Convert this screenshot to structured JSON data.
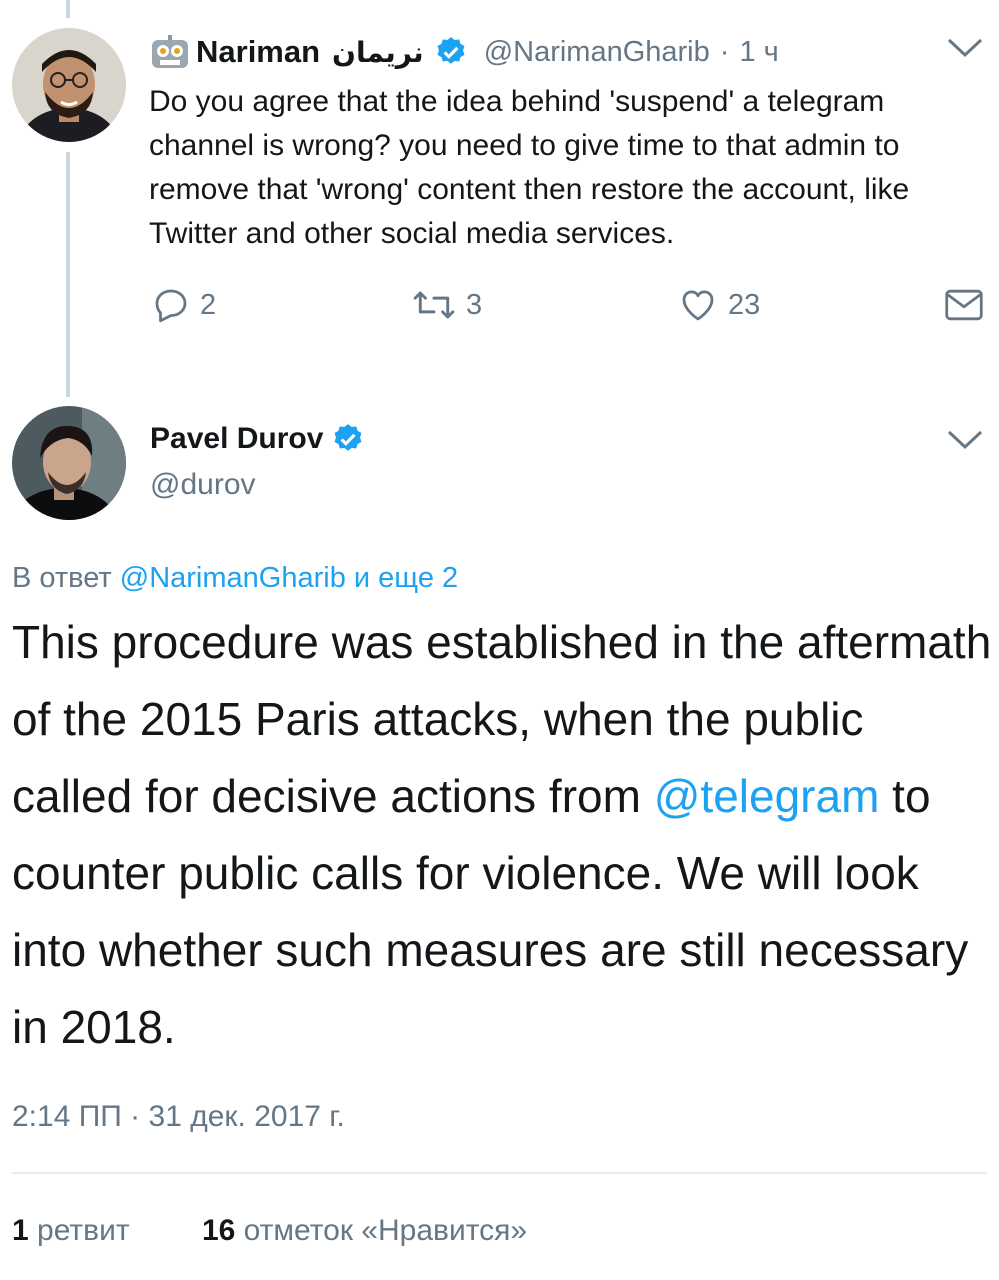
{
  "parent_tweet": {
    "display_name": "Nariman",
    "display_name_arabic": "نريمان",
    "handle": "@NarimanGharib",
    "time_sep": "·",
    "time": "1 ч",
    "text": "Do you agree that the idea behind 'suspend' a telegram channel is wrong? you need to give time to that admin to remove that 'wrong' content then restore the account, like Twitter and other social media services.",
    "replies": "2",
    "retweets": "3",
    "likes": "23"
  },
  "main_tweet": {
    "display_name": "Pavel Durov",
    "handle": "@durov",
    "reply_prefix": "В ответ",
    "reply_to": "@NarimanGharib",
    "reply_suffix": "и еще 2",
    "text_before": "This procedure was established in the aftermath of the 2015 Paris attacks, when the public called for decisive actions from ",
    "mention": "@telegram",
    "text_after": " to counter public calls for violence. We will look into whether such measures are still necessary in 2018.",
    "timestamp": "2:14 ПП · 31 дек. 2017 г.",
    "retweet_count": "1",
    "retweet_label": "ретвит",
    "like_count": "16",
    "like_label": "отметок «Нравится»"
  },
  "colors": {
    "accent": "#1da1f2",
    "muted": "#657786",
    "text": "#14171a",
    "divider": "#e6ecf0"
  }
}
